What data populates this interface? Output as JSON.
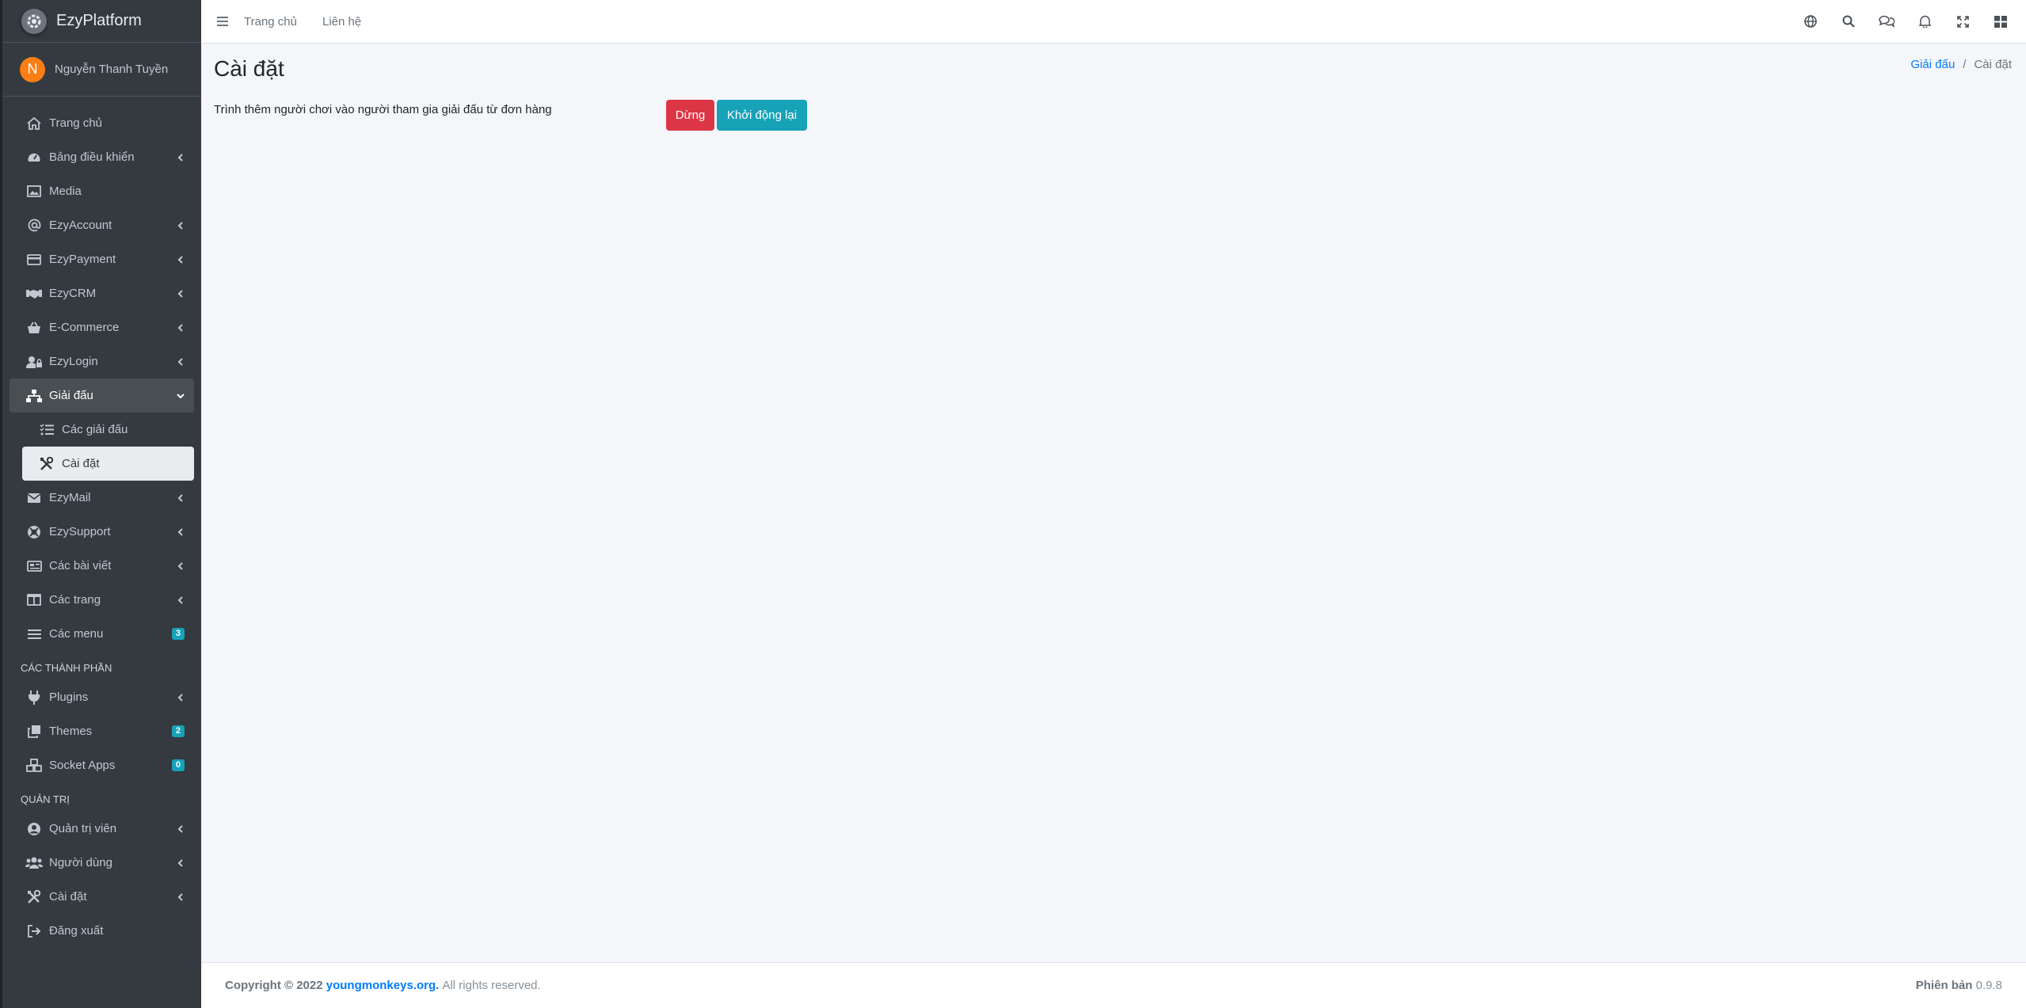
{
  "brand": {
    "name": "EzyPlatform",
    "logo_icon": "gear-logo-icon"
  },
  "user": {
    "initial": "N",
    "name": "Nguyễn Thanh Tuyền",
    "avatar_color": "#fd7e14"
  },
  "sidebar": {
    "items": [
      {
        "label": "Trang chủ",
        "icon": "home-icon"
      },
      {
        "label": "Bảng điều khiển",
        "icon": "dashboard-icon",
        "expandable": true
      },
      {
        "label": "Media",
        "icon": "image-icon"
      },
      {
        "label": "EzyAccount",
        "icon": "at-icon",
        "expandable": true
      },
      {
        "label": "EzyPayment",
        "icon": "credit-card-icon",
        "expandable": true
      },
      {
        "label": "EzyCRM",
        "icon": "handshake-icon",
        "expandable": true
      },
      {
        "label": "E-Commerce",
        "icon": "basket-icon",
        "expandable": true
      },
      {
        "label": "EzyLogin",
        "icon": "user-lock-icon",
        "expandable": true
      },
      {
        "label": "Giải đấu",
        "icon": "sitemap-icon",
        "expanded": true
      },
      {
        "label": "Các giải đấu",
        "icon": "list-check-icon",
        "sub": true
      },
      {
        "label": "Cài đặt",
        "icon": "tools-icon",
        "sub": true,
        "active": true
      },
      {
        "label": "EzyMail",
        "icon": "envelope-icon",
        "expandable": true
      },
      {
        "label": "EzySupport",
        "icon": "life-ring-icon",
        "expandable": true
      },
      {
        "label": "Các bài viết",
        "icon": "newspaper-icon",
        "expandable": true
      },
      {
        "label": "Các trang",
        "icon": "columns-icon",
        "expandable": true
      },
      {
        "label": "Các menu",
        "icon": "bars-icon",
        "badge": "3"
      }
    ],
    "header_components": "CÁC THÀNH PHẦN",
    "components": [
      {
        "label": "Plugins",
        "icon": "plug-icon",
        "expandable": true
      },
      {
        "label": "Themes",
        "icon": "clone-icon",
        "badge": "2"
      },
      {
        "label": "Socket Apps",
        "icon": "cubes-icon",
        "badge": "0"
      }
    ],
    "header_admin": "QUẢN TRỊ",
    "admin": [
      {
        "label": "Quản trị viên",
        "icon": "user-circle-icon",
        "expandable": true
      },
      {
        "label": "Người dùng",
        "icon": "users-icon",
        "expandable": true
      },
      {
        "label": "Cài đặt",
        "icon": "tools-icon",
        "expandable": true
      },
      {
        "label": "Đăng xuất",
        "icon": "sign-out-icon"
      }
    ]
  },
  "topbar": {
    "home": "Trang chủ",
    "contact": "Liên hệ"
  },
  "page": {
    "title": "Cài đặt",
    "breadcrumb_link": "Giải đấu",
    "breadcrumb_sep": "/",
    "breadcrumb_current": "Cài đặt",
    "description": "Trình thêm người chơi vào người tham gia giải đấu từ đơn hàng",
    "stop_label": "Dừng",
    "restart_label": "Khởi động lại"
  },
  "footer": {
    "copyright": "Copyright © 2022",
    "link": "youngmonkeys.org.",
    "rights": "All rights reserved.",
    "version_label": "Phiên bản",
    "version": "0.9.8"
  },
  "colors": {
    "sidebar_bg": "#343a40",
    "danger": "#dc3545",
    "info": "#17a2b8",
    "primary": "#007bff"
  }
}
